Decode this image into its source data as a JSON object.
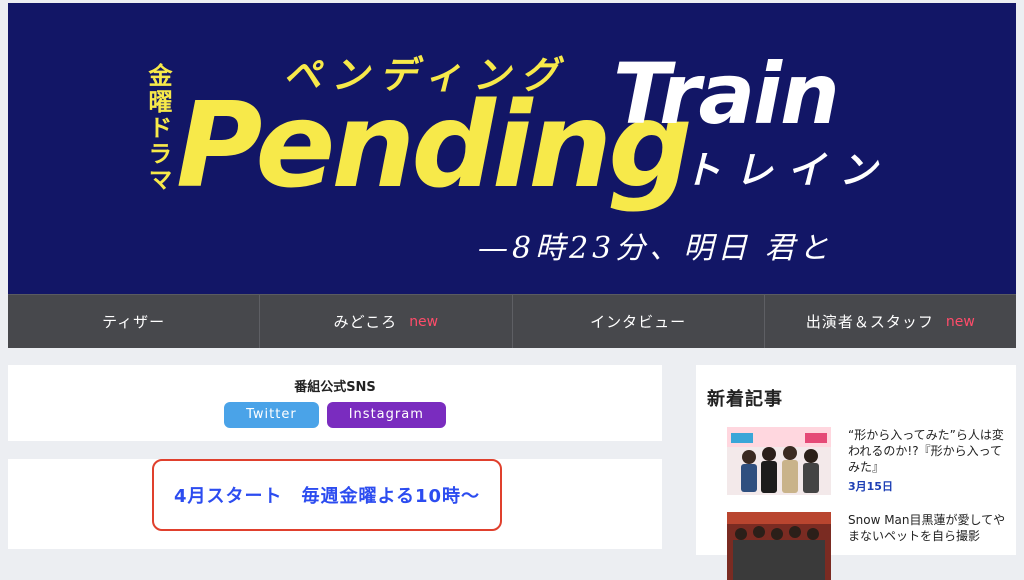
{
  "banner": {
    "prefix": "金曜ドラマ",
    "kana_top": "ペンディング",
    "title_yellow": "Pending",
    "title_white": "Train",
    "kana_bottom": "トレイン",
    "tagline": "—8時23分、明日 君と",
    "colors": {
      "background": "#121666",
      "yellow": "#f7e94a",
      "white": "#ffffff"
    }
  },
  "nav": {
    "items": [
      {
        "label": "ティザー",
        "badge": ""
      },
      {
        "label": "みどころ",
        "badge": "new"
      },
      {
        "label": "インタビュー",
        "badge": ""
      },
      {
        "label": "出演者＆スタッフ",
        "badge": "new"
      }
    ]
  },
  "sns": {
    "title": "番組公式SNS",
    "twitter_label": "Twitter",
    "instagram_label": "Instagram"
  },
  "schedule": {
    "text": "4月スタート　毎週金曜よる10時〜"
  },
  "sidebar": {
    "title": "新着記事",
    "articles": [
      {
        "title": "“形から入ってみた”ら人は変われるのか!?『形から入ってみた』",
        "date": "3月15日"
      },
      {
        "title": "Snow Man目黒蓮が愛してやまないペットを自ら撮影",
        "date": ""
      }
    ]
  }
}
